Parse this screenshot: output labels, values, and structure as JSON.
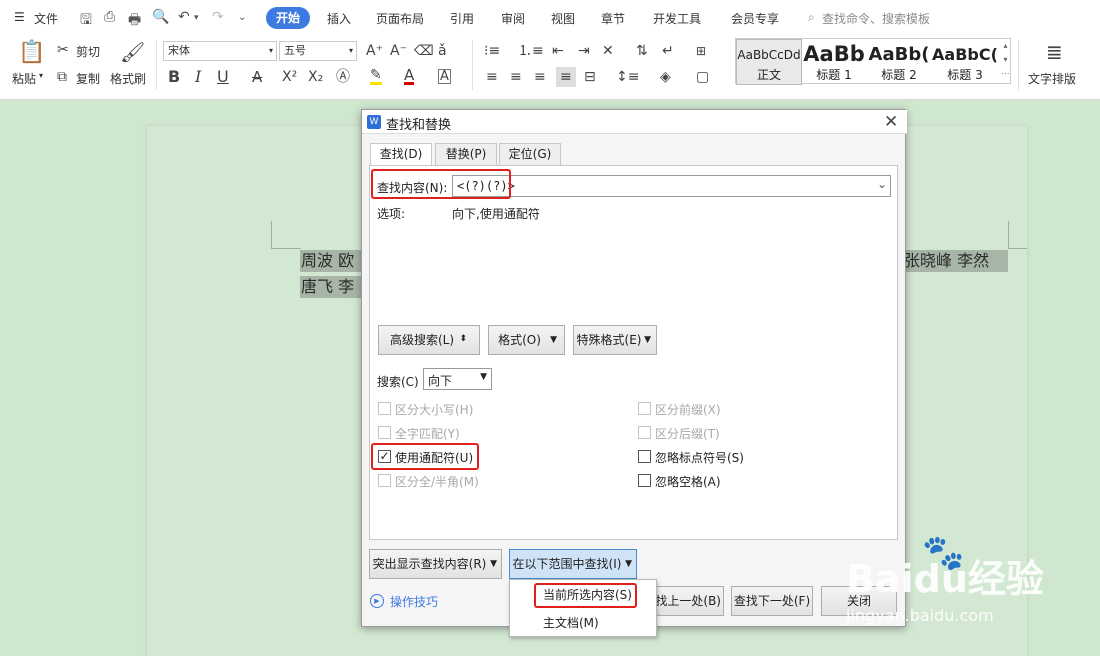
{
  "menubar": {
    "file": "文件",
    "tabs": [
      "开始",
      "插入",
      "页面布局",
      "引用",
      "审阅",
      "视图",
      "章节",
      "开发工具",
      "会员专享"
    ],
    "search_placeholder": "查找命令、搜索模板"
  },
  "ribbon": {
    "paste": "粘贴",
    "cut": "剪切",
    "copy": "复制",
    "format_painter": "格式刷",
    "font_name": "宋体",
    "font_size": "五号",
    "bold": "B",
    "italic": "I",
    "underline": "U",
    "styles": [
      {
        "preview": "AaBbCcDd",
        "name": "正文"
      },
      {
        "preview": "AaBb",
        "name": "标题 1"
      },
      {
        "preview": "AaBb(",
        "name": "标题 2"
      },
      {
        "preview": "AaBbC(",
        "name": "标题 3"
      }
    ],
    "text_layout": "文字排版"
  },
  "document": {
    "line1_left": "周波  欧",
    "line1_right": "张晓峰  李然",
    "line2_left": "唐飞  李"
  },
  "dialog": {
    "title": "查找和替换",
    "tabs": [
      "查找(D)",
      "替换(P)",
      "定位(G)"
    ],
    "find_label": "查找内容(N):",
    "find_value": "<(?)(?)>",
    "options_label": "选项:",
    "options_value": "向下,使用通配符",
    "advanced_search": "高级搜索(L)",
    "format": "格式(O)",
    "special": "特殊格式(E)",
    "search_label": "搜索(C)",
    "search_direction": "向下",
    "checkboxes": [
      {
        "label": "区分大小写(H)",
        "checked": false,
        "enabled": false
      },
      {
        "label": "全字匹配(Y)",
        "checked": false,
        "enabled": false
      },
      {
        "label": "使用通配符(U)",
        "checked": true,
        "enabled": true
      },
      {
        "label": "区分全/半角(M)",
        "checked": false,
        "enabled": false
      },
      {
        "label": "区分前缀(X)",
        "checked": false,
        "enabled": false
      },
      {
        "label": "区分后缀(T)",
        "checked": false,
        "enabled": false
      },
      {
        "label": "忽略标点符号(S)",
        "checked": false,
        "enabled": true
      },
      {
        "label": "忽略空格(A)",
        "checked": false,
        "enabled": true
      }
    ],
    "highlight_btn": "突出显示查找内容(R)",
    "find_in_btn": "在以下范围中查找(I)",
    "find_prev": "查找上一处(B)",
    "find_prev_visible": "找上一处(B)",
    "find_next": "查找下一处(F)",
    "close": "关闭",
    "tips": "操作技巧",
    "dropdown_items": [
      "当前所选内容(S)",
      "主文档(M)"
    ]
  },
  "watermark": {
    "brand": "Baidu经验",
    "url": "jingyan.baidu.com"
  },
  "colors": {
    "accent": "#3d7be0",
    "highlight_box": "#e0201c",
    "page_bg": "#cfe6cf"
  }
}
